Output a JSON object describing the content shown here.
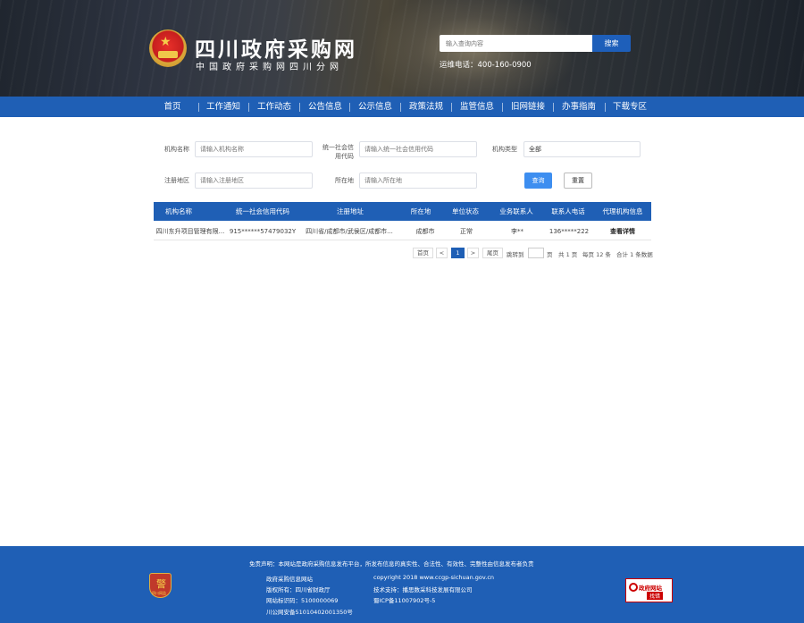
{
  "header": {
    "title": "四川政府采购网",
    "subtitle": "中国政府采购网四川分网",
    "search_placeholder": "输入查询内容",
    "search_button": "搜索",
    "hotline": "运维电话：400-160-0900"
  },
  "nav": [
    "首页",
    "工作通知",
    "工作动态",
    "公告信息",
    "公示信息",
    "政策法规",
    "监管信息",
    "旧网链接",
    "办事指南",
    "下载专区"
  ],
  "filters": {
    "org_name_label": "机构名称",
    "org_name_placeholder": "请输入机构名称",
    "credit_code_label_1": "统一社会信",
    "credit_code_label_2": "用代码",
    "credit_code_placeholder": "请输入统一社会信用代码",
    "org_type_label": "机构类型",
    "org_type_value": "全部",
    "reg_area_label": "注册地区",
    "reg_area_placeholder": "请输入注册地区",
    "location_label": "所在地",
    "location_placeholder": "请输入所在地",
    "query_button": "查询",
    "reset_button": "重置"
  },
  "table": {
    "columns": [
      "机构名称",
      "统一社会信用代码",
      "注册地址",
      "所在地",
      "单位状态",
      "业务联系人",
      "联系人电话",
      "代理机构信息"
    ],
    "rows": [
      [
        "四川东升项目管理有限...",
        "915******57479032Y",
        "四川省/成都市/武侯区/成都市...",
        "成都市",
        "正常",
        "李**",
        "136*****222",
        "查看详情"
      ]
    ]
  },
  "pagination": {
    "first": "首页",
    "prev": "<",
    "current": "1",
    "next": ">",
    "last": "尾页",
    "jump_to": "跳转到",
    "page_unit": "页",
    "total_pages": "共 1 页",
    "per_page": "每页 12 条",
    "total_records": "合计 1 条数据"
  },
  "footer": {
    "disclaimer": "免责声明：本网站是政府采购信息发布平台，所发布信息的真实性、合法性、有效性、完整性由信息发布者负责",
    "left": [
      "政府采购信息网站",
      "版权所有：四川省财政厅",
      "网站标识码：5100000069",
      "川公网安备51010402001350号"
    ],
    "right": [
      "copyright 2018 www.ccgp-sichuan.gov.cn",
      "技术支持：播思数采科技发展有限公司",
      "蜀ICP备11007902号-5"
    ],
    "police_label": "四川网监",
    "gov_badge_1": "政府网站",
    "gov_badge_2": "找错"
  },
  "colors": {
    "brand_blue": "#1f5fb5",
    "query_blue": "#3d8ef0"
  }
}
